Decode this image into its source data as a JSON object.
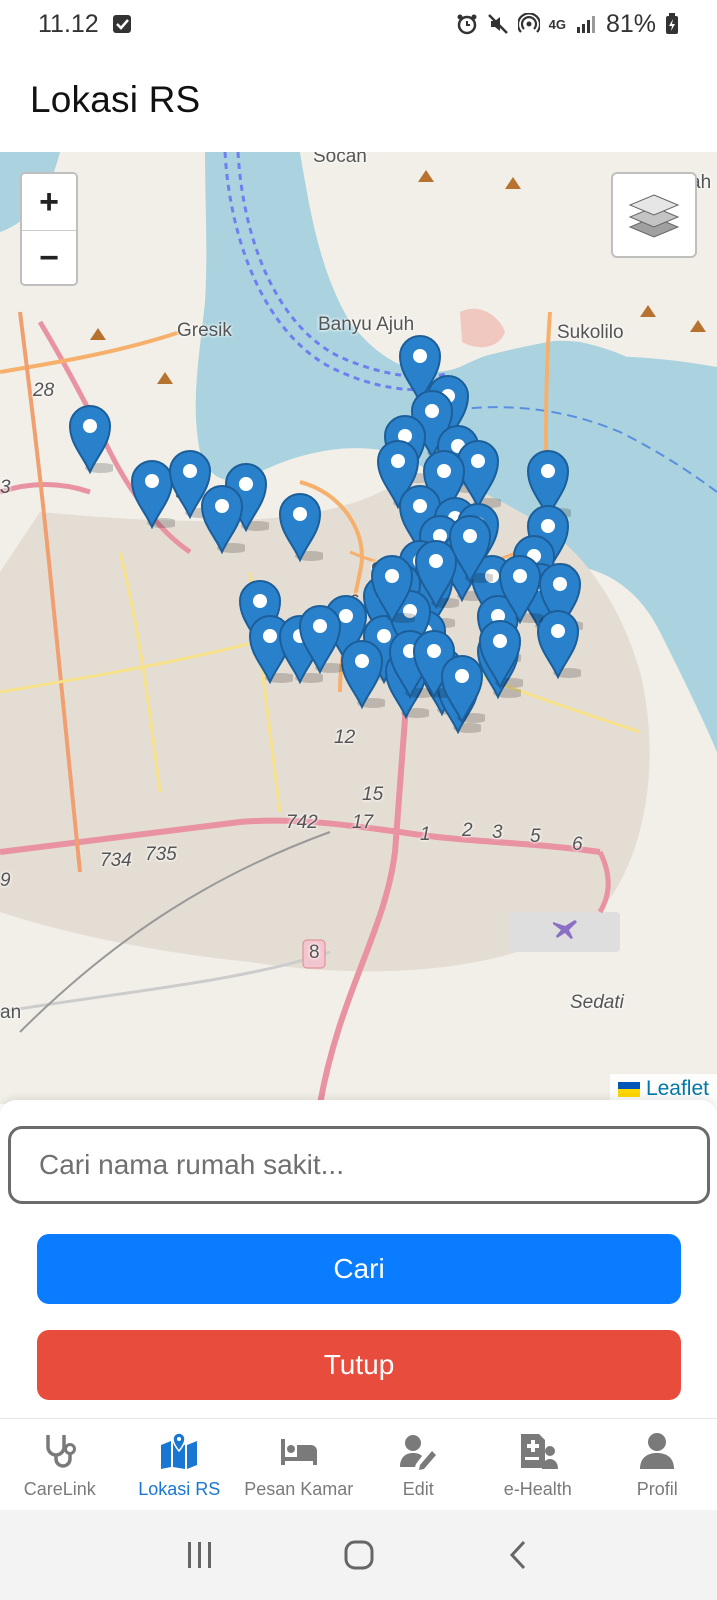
{
  "status_bar": {
    "time": "11.12",
    "network": "4G",
    "battery": "81%",
    "icons": [
      "checkbox-notification-icon",
      "alarm-icon",
      "mute-icon",
      "hotspot-icon",
      "signal-icon",
      "battery-icon"
    ]
  },
  "app_bar": {
    "title": "Lokasi RS"
  },
  "map": {
    "labels": [
      "Socah",
      "Gresik",
      "Banyu Ajuh",
      "Sukolilo",
      "28",
      "9",
      "6",
      "Su",
      "12",
      "15",
      "742",
      "17",
      "1",
      "2",
      "3",
      "5",
      "6",
      "734",
      "735",
      "8",
      "Sedati",
      "an",
      "ah",
      "3",
      "9"
    ],
    "zoom_in": "+",
    "zoom_out": "−",
    "attribution": "Leaflet",
    "colors": {
      "water": "#aad3df",
      "land": "#f2efe9",
      "marker": "#2a81cb"
    },
    "marker_icon": "map-marker-icon",
    "marker_count": 52
  },
  "search": {
    "placeholder": "Cari nama rumah sakit...",
    "value": "",
    "cari_label": "Cari",
    "tutup_label": "Tutup",
    "colors": {
      "cari": "#0a7cff",
      "tutup": "#e74c3c"
    }
  },
  "bottom_nav": {
    "items": [
      {
        "label": "CareLink",
        "icon": "stethoscope-icon",
        "active": false
      },
      {
        "label": "Lokasi RS",
        "icon": "map-location-icon",
        "active": true
      },
      {
        "label": "Pesan Kamar",
        "icon": "bed-icon",
        "active": false
      },
      {
        "label": "Edit",
        "icon": "user-edit-icon",
        "active": false
      },
      {
        "label": "e-Health",
        "icon": "medical-file-icon",
        "active": false
      },
      {
        "label": "Profil",
        "icon": "user-icon",
        "active": false
      }
    ],
    "active_color": "#1976d2",
    "inactive_color": "#7a7a7a"
  },
  "system_nav": {
    "icons": [
      "recent-apps-icon",
      "home-icon",
      "back-icon"
    ]
  }
}
